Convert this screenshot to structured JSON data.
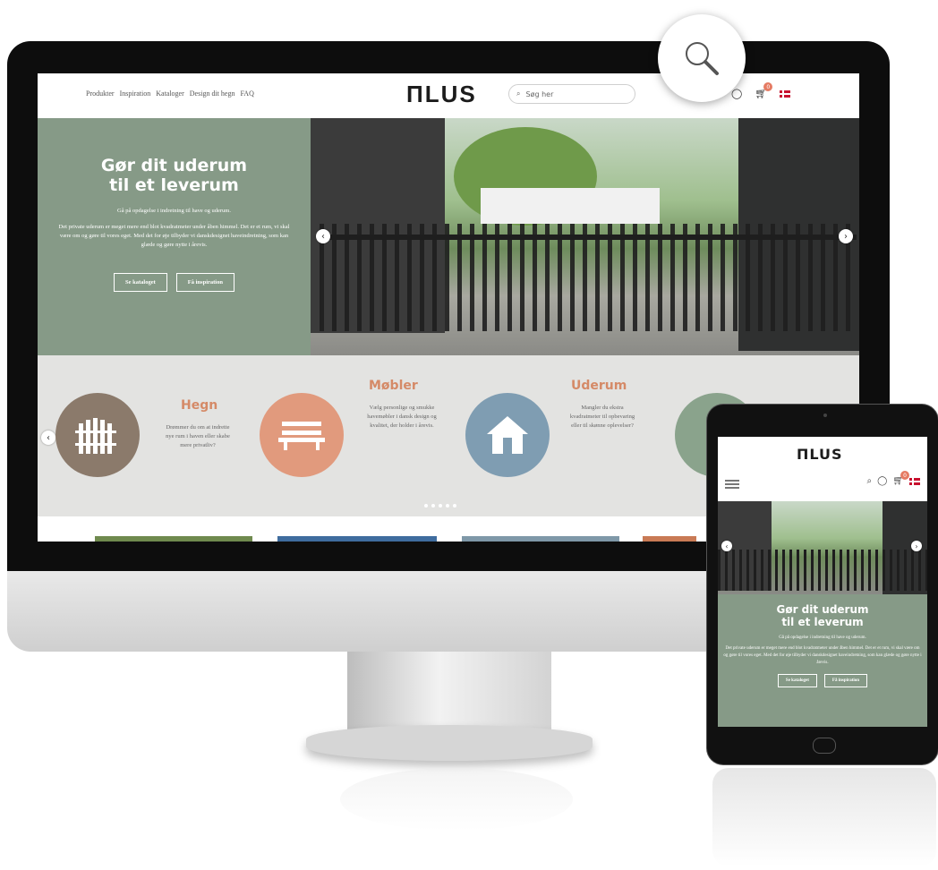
{
  "nav": {
    "items": [
      "Produkter",
      "Inspiration",
      "Kataloger",
      "Design dit hegn",
      "FAQ"
    ]
  },
  "logo": "ПLUS",
  "search": {
    "placeholder": "Søg her"
  },
  "cart": {
    "count": "0"
  },
  "hero": {
    "title_line1": "Gør dit uderum",
    "title_line2": "til et leverum",
    "subtitle": "Gå på opdagelse i indretning til have og uderum.",
    "body": "Det private uderum er meget mere end blot kvadratmeter under åben himmel. Det er et rum, vi skal være om og gøre til vores eget. Med det for øje tilbyder vi danskdesignet haveindretning, som kan glæde og gøre nytte i årevis.",
    "btn_catalog": "Se kataloget",
    "btn_inspiration": "Få inspiration"
  },
  "categories": [
    {
      "title": "Hegn",
      "desc": "Drømmer du om at indrette nye rum i haven eller skabe mere privatliv?",
      "color": "#8b7a6b",
      "title_color": "#d58a67"
    },
    {
      "title": "Møbler",
      "desc": "Vælg personlige og smukke havemøbler i dansk design og kvalitet, der holder i årevis.",
      "color": "#e19a7d",
      "title_color": "#d58a67"
    },
    {
      "title": "Uderum",
      "desc": "Mangler du ekstra kvadratmeter til opbevaring eller til skønne oplevelser?",
      "color": "#7f9db2",
      "title_color": "#d58a67"
    }
  ],
  "colors": {
    "hero_green": "#869a87",
    "accent": "#d58a67",
    "cat_bg": "#e3e3e1"
  },
  "tablet": {
    "logo": "ПLUS",
    "title_line1": "Gør dit uderum",
    "title_line2": "til et leverum",
    "subtitle": "Gå på opdagelse i indretning til have og uderum.",
    "body": "Det private uderum er meget mere end blot kvadratmeter under åben himmel. Det er et rum, vi skal være om og gøre til vores eget. Med det for øje tilbyder vi danskdesignet haveindretning, som kan glæde og gøre nytte i årevis.",
    "btn_catalog": "Se kataloget",
    "btn_inspiration": "Få inspiration",
    "cart_count": "0"
  }
}
